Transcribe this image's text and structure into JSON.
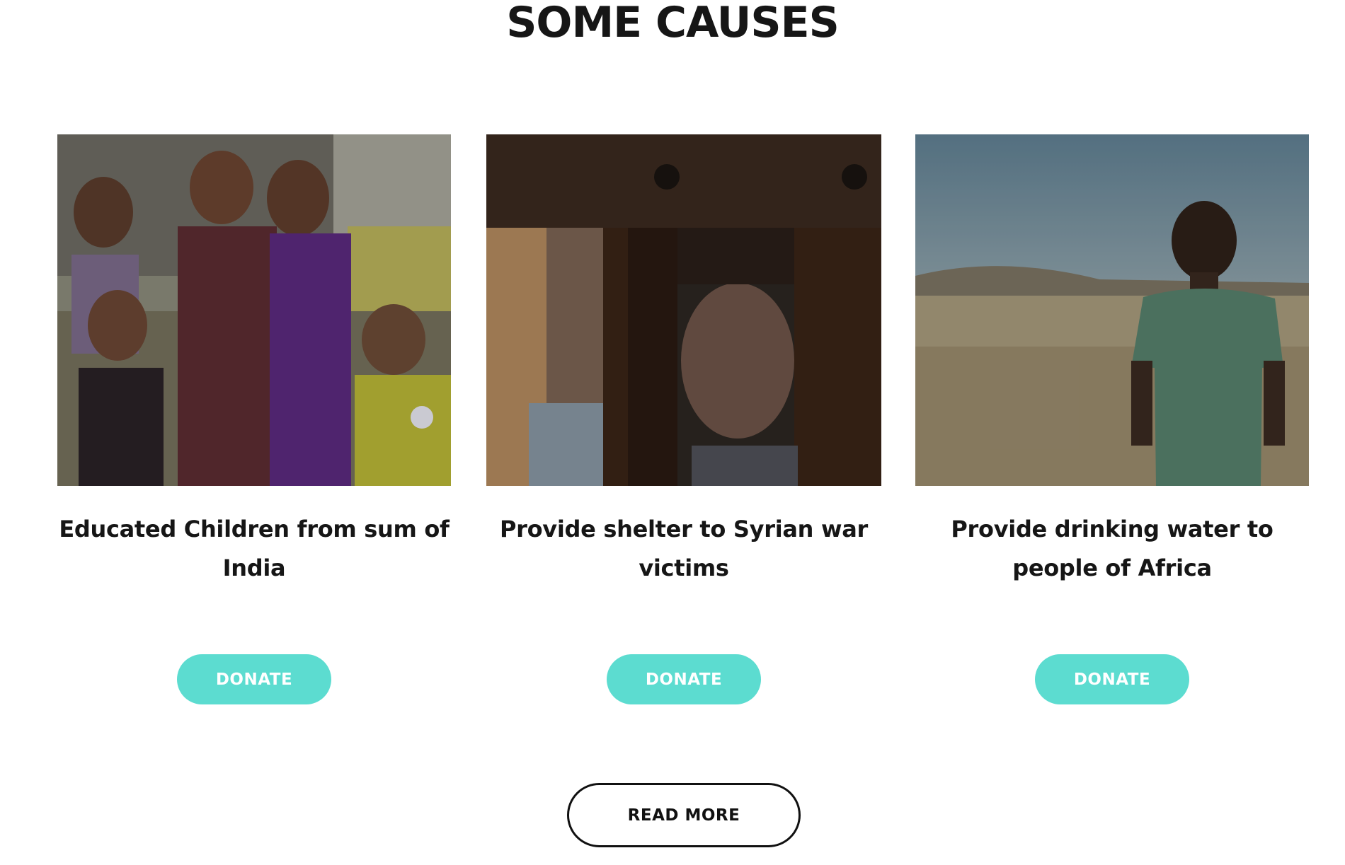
{
  "section": {
    "title": "SOME CAUSES"
  },
  "causes": [
    {
      "title": "Educated Children from sum of India",
      "image": "group-of-children-photo",
      "donate_label": "DONATE"
    },
    {
      "title": "Provide shelter to Syrian war victims",
      "image": "child-behind-wooden-bars-photo",
      "donate_label": "DONATE"
    },
    {
      "title": "Provide drinking water to people of Africa",
      "image": "child-in-dry-field-photo",
      "donate_label": "DONATE"
    }
  ],
  "read_more_label": "READ MORE",
  "colors": {
    "accent": "#5cdcd0",
    "text": "#161616",
    "background": "#ffffff"
  }
}
